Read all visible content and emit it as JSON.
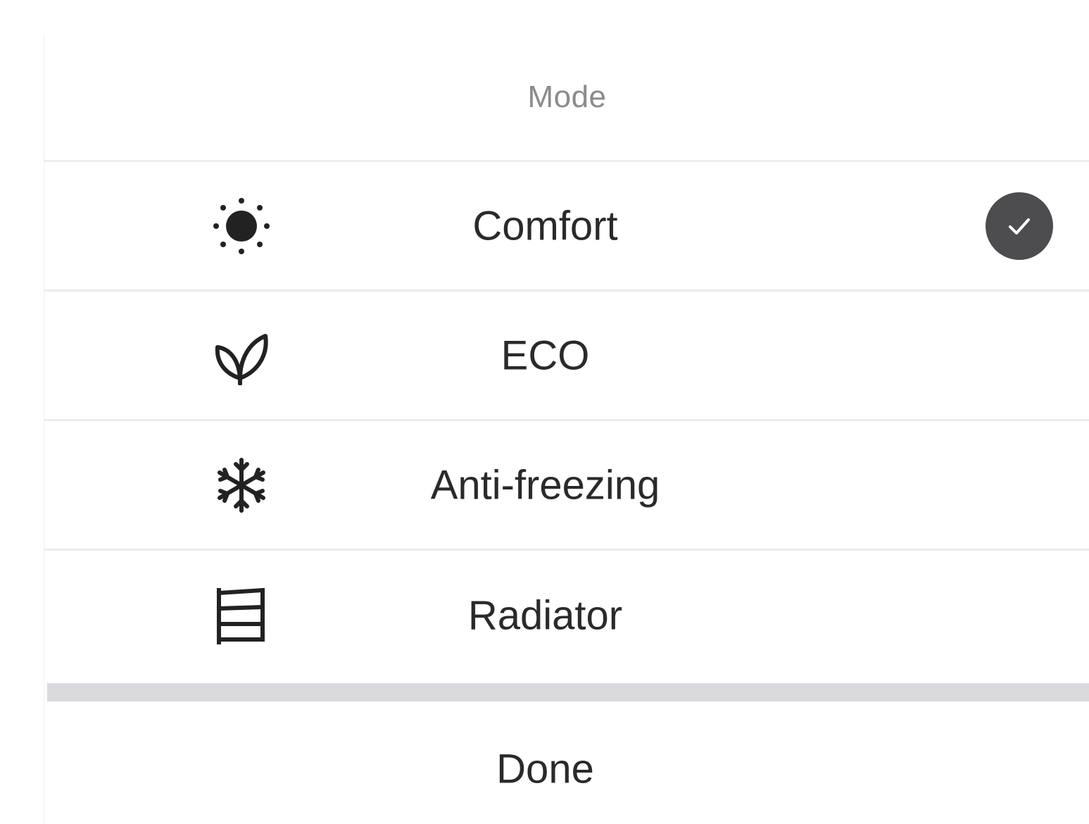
{
  "header": {
    "title": "Mode"
  },
  "modes": [
    {
      "label": "Comfort",
      "icon": "sun-icon",
      "selected": true
    },
    {
      "label": "ECO",
      "icon": "leaf-icon",
      "selected": false
    },
    {
      "label": "Anti-freezing",
      "icon": "snowflake-icon",
      "selected": false
    },
    {
      "label": "Radiator",
      "icon": "radiator-icon",
      "selected": false
    }
  ],
  "footer": {
    "done_label": "Done"
  },
  "colors": {
    "selected_check_bg": "#4d4d4f",
    "separator": "#d9d9de",
    "text": "#2a2a2c",
    "header_text": "#8b8b8f"
  }
}
